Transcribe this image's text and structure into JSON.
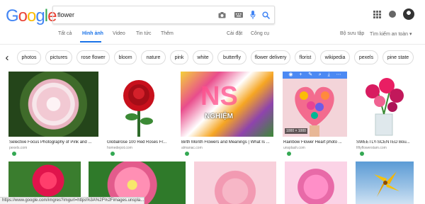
{
  "logo": {
    "letters": [
      "G",
      "o",
      "o",
      "g",
      "l",
      "e"
    ],
    "colors": [
      "#4285f4",
      "#ea4335",
      "#fbbc05",
      "#4285f4",
      "#34a853",
      "#ea4335"
    ]
  },
  "search": {
    "query": "flower",
    "icons": [
      "camera-icon",
      "keyboard-icon",
      "mic-icon",
      "search-icon"
    ]
  },
  "header_icons": [
    "apps-grid-icon",
    "notifications-icon",
    "account-avatar"
  ],
  "nav": {
    "tabs": [
      "Tất cả",
      "Hình ảnh",
      "Video",
      "Tin tức",
      "Thêm"
    ],
    "active_tab": "Hình ảnh",
    "tools": [
      "Cài đặt",
      "Công cụ"
    ],
    "right": [
      "Bộ sưu tập",
      "Tìm kiếm an toàn ▾"
    ],
    "accent_color": "#1a73e8"
  },
  "chips": [
    "photos",
    "pictures",
    "rose flower",
    "bloom",
    "nature",
    "pink",
    "white",
    "butterfly",
    "flower delivery",
    "florist",
    "wikipedia",
    "pexels",
    "pine state"
  ],
  "results_row1": [
    {
      "title": "Selective Focus Photography of Pink and ...",
      "source": "pexels.com"
    },
    {
      "title": "Globalrose 100 Red Roses Fr...",
      "source": "homedepot.com"
    },
    {
      "title": "Birth Month Flowers and Meanings | What Is ...",
      "source": "almanac.com"
    },
    {
      "title": "Rainbow Flower Heart photo ...",
      "source": "unsplash.com",
      "dimensions": "1000 × 1000"
    },
    {
      "title": "SWEETLY-SCENTED Bou...",
      "source": "fiftyflowerstam.com"
    }
  ],
  "hover_overlay_icons": [
    "view-icon",
    "add-icon",
    "edit-icon",
    "search-icon",
    "download-icon",
    "more-icon"
  ],
  "watermark": {
    "line1": "NS",
    "line2": "NGHIỆM"
  },
  "status_url": "https://www.google.com/imgres?imgurl=https%3A%2F%2Fimages.unspla..."
}
